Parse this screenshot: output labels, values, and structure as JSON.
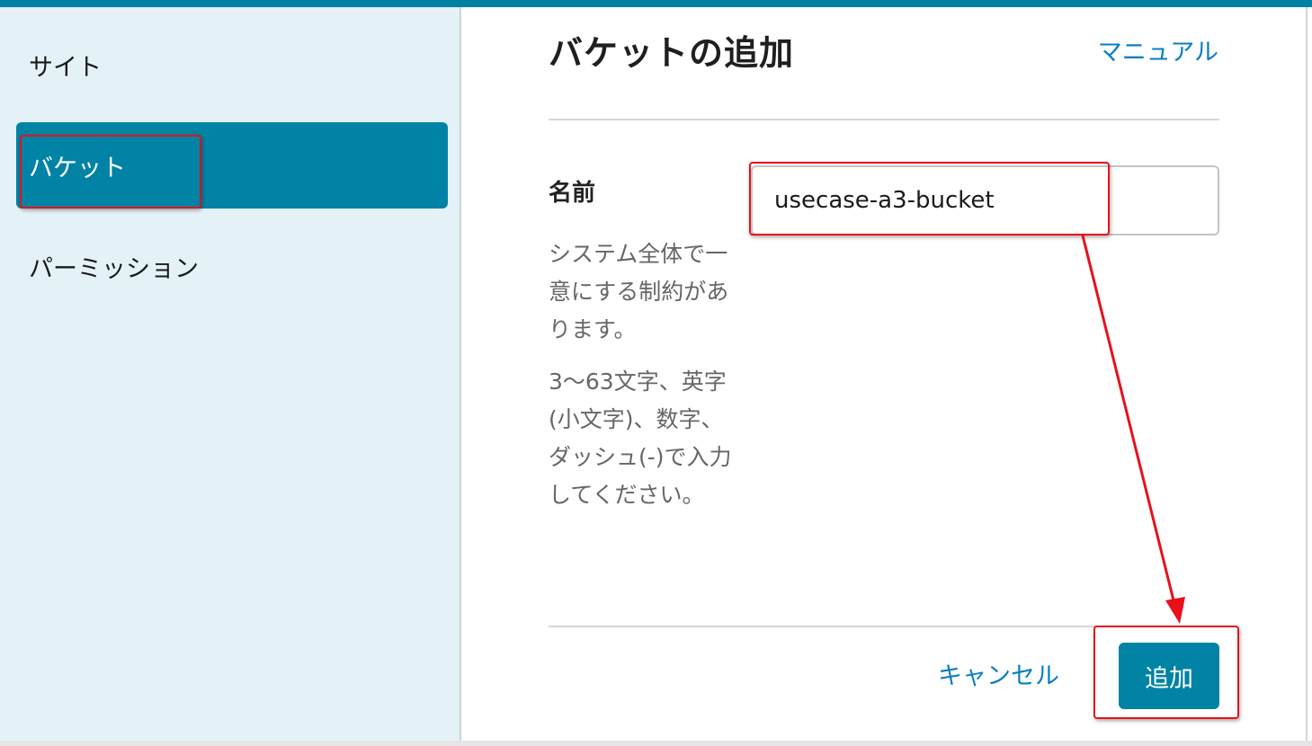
{
  "sidebar": {
    "items": [
      {
        "label": "サイト"
      },
      {
        "label": "バケット"
      },
      {
        "label": "パーミッション"
      }
    ]
  },
  "header": {
    "title": "バケットの追加",
    "manual_link": "マニュアル"
  },
  "form": {
    "name_label": "名前",
    "name_value": "usecase-a3-bucket",
    "help_unique": "システム全体で一意にする制約があります。",
    "help_chars": "3〜63文字、英字(小文字)、数字、ダッシュ(-)で入力してください。"
  },
  "actions": {
    "cancel_label": "キャンセル",
    "add_label": "追加"
  },
  "colors": {
    "accent": "#0083a5",
    "link": "#0a7ec0",
    "annotation": "#e8101a",
    "sidebar_bg": "#e4f2f7"
  }
}
